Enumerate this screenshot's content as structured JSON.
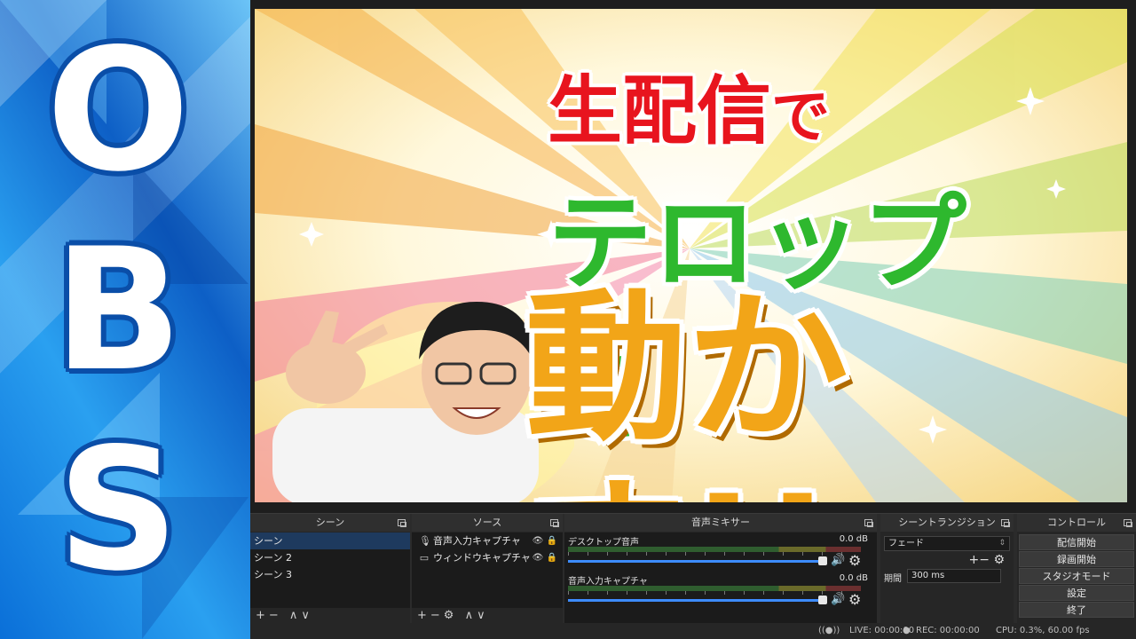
{
  "banner": {
    "letters": [
      "O",
      "B",
      "S"
    ]
  },
  "thumbnail": {
    "line1_main": "生配信",
    "line1_particle": "で",
    "line2": "テロップを",
    "line3": "動かす!!"
  },
  "panels": {
    "scenes": {
      "title": "シーン",
      "items": [
        "シーン",
        "シーン 2",
        "シーン 3"
      ],
      "footer": "+− ∧∨"
    },
    "sources": {
      "title": "ソース",
      "items": [
        {
          "label": "音声入力キャプチャ",
          "icon": "microphone-icon"
        },
        {
          "label": "ウィンドウキャプチャ",
          "icon": "window-icon"
        }
      ],
      "footer": "+−⚙ ∧∨"
    },
    "mixer": {
      "title": "音声ミキサー",
      "channels": [
        {
          "name": "デスクトップ音声",
          "db": "0.0 dB"
        },
        {
          "name": "音声入力キャプチャ",
          "db": "0.0 dB"
        }
      ]
    },
    "transitions": {
      "title": "シーントランジション",
      "selected": "フェード",
      "duration_label": "期間",
      "duration_value": "300 ms"
    },
    "controls": {
      "title": "コントロール",
      "buttons": [
        "配信開始",
        "録画開始",
        "スタジオモード",
        "設定",
        "終了"
      ]
    }
  },
  "status": {
    "live": "LIVE: 00:00:00",
    "rec": "REC: 00:00:00",
    "cpu": "CPU: 0.3%, 60.00 fps"
  }
}
